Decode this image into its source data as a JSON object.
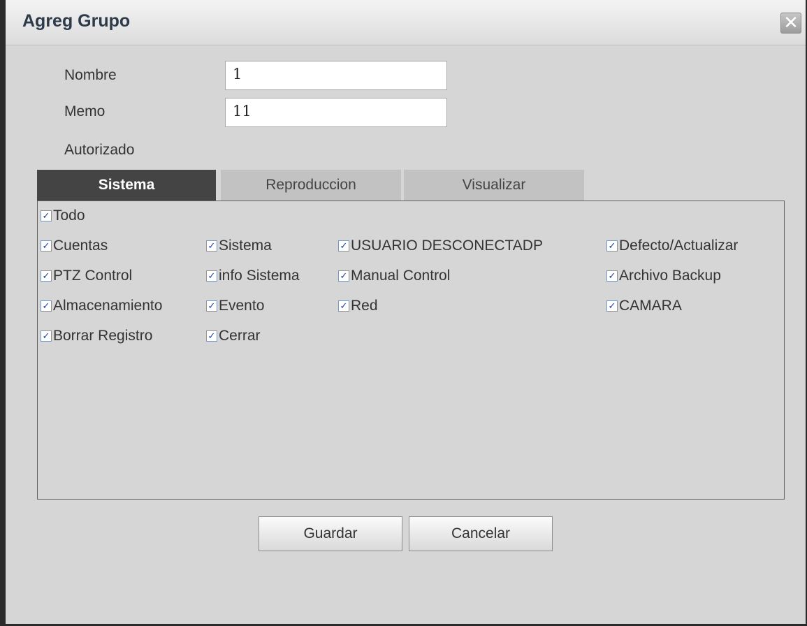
{
  "dialog": {
    "title": "Agreg Grupo",
    "close_symbol": "✕"
  },
  "form": {
    "name_label": "Nombre",
    "name_value": "1",
    "memo_label": "Memo",
    "memo_value": "11",
    "authorized_label": "Autorizado"
  },
  "tabs": [
    {
      "label": "Sistema",
      "active": true
    },
    {
      "label": "Reproduccion",
      "active": false
    },
    {
      "label": "Visualizar",
      "active": false
    }
  ],
  "permissions": {
    "all": {
      "label": "Todo",
      "checked": true
    },
    "items": [
      {
        "label": "Cuentas",
        "checked": true
      },
      {
        "label": "Sistema",
        "checked": true
      },
      {
        "label": "USUARIO DESCONECTADP",
        "checked": true
      },
      {
        "label": "Defecto/Actualizar",
        "checked": true
      },
      {
        "label": "PTZ Control",
        "checked": true
      },
      {
        "label": "info Sistema",
        "checked": true
      },
      {
        "label": "Manual Control",
        "checked": true
      },
      {
        "label": "Archivo Backup",
        "checked": true
      },
      {
        "label": "Almacenamiento",
        "checked": true
      },
      {
        "label": "Evento",
        "checked": true
      },
      {
        "label": "Red",
        "checked": true
      },
      {
        "label": "CAMARA",
        "checked": true
      },
      {
        "label": "Borrar Registro",
        "checked": true
      },
      {
        "label": "Cerrar",
        "checked": true
      }
    ],
    "check_symbol": "✓"
  },
  "buttons": {
    "save_label": "Guardar",
    "cancel_label": "Cancelar"
  },
  "icons": {
    "close": "close-icon",
    "checkbox": "checkmark-icon"
  }
}
